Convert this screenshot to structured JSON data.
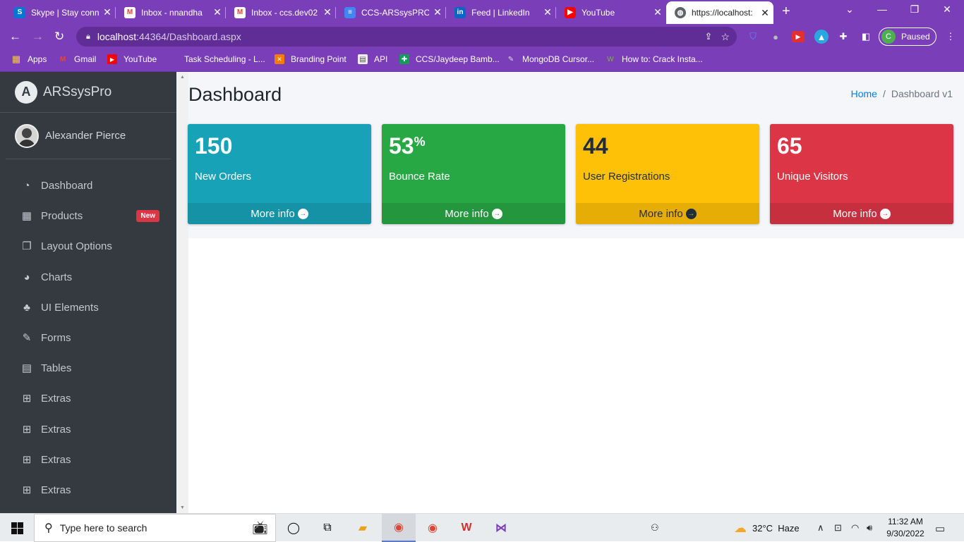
{
  "browser": {
    "tabs": [
      {
        "title": "Skype | Stay conn",
        "icon": "skype-icon",
        "icon_color": "#0078d4"
      },
      {
        "title": "Inbox - nnandha",
        "icon": "gmail-icon",
        "icon_color": "#ea4335"
      },
      {
        "title": "Inbox - ccs.dev02",
        "icon": "gmail-icon",
        "icon_color": "#ea4335"
      },
      {
        "title": "CCS-ARSsysPRO_",
        "icon": "docs-icon",
        "icon_color": "#4285f4"
      },
      {
        "title": "Feed | LinkedIn",
        "icon": "linkedin-icon",
        "icon_color": "#0a66c2"
      },
      {
        "title": "YouTube",
        "icon": "youtube-icon",
        "icon_color": "#ff0000"
      },
      {
        "title": "https://localhost:",
        "icon": "globe-icon",
        "icon_color": "#5f6368"
      }
    ],
    "url_host": "localhost",
    "url_path": ":44364/Dashboard.aspx",
    "profile_initial": "C",
    "profile_status": "Paused",
    "bookmarks": [
      {
        "label": "Apps",
        "icon": "apps-grid-icon"
      },
      {
        "label": "Gmail",
        "icon": "gmail-icon"
      },
      {
        "label": "YouTube",
        "icon": "youtube-icon"
      },
      {
        "label": "Task Scheduling - L...",
        "icon": "bookmark-icon"
      },
      {
        "label": "Branding Point",
        "icon": "branding-icon"
      },
      {
        "label": "API",
        "icon": "page-icon"
      },
      {
        "label": "CCS/Jaydeep Bamb...",
        "icon": "sheets-icon"
      },
      {
        "label": "MongoDB Cursor...",
        "icon": "mongodb-icon"
      },
      {
        "label": "How to: Crack Insta...",
        "icon": "wonderhowto-icon"
      }
    ]
  },
  "sidebar": {
    "brand": "ARSsysPro",
    "brand_initial": "A",
    "user_name": "Alexander Pierce",
    "items": [
      {
        "label": "Dashboard",
        "icon": "tachometer-icon",
        "glyph": "◔"
      },
      {
        "label": "Products",
        "icon": "grid-icon",
        "glyph": "▦",
        "badge": "New"
      },
      {
        "label": "Layout Options",
        "icon": "copy-icon",
        "glyph": "❐"
      },
      {
        "label": "Charts",
        "icon": "pie-chart-icon",
        "glyph": "◕"
      },
      {
        "label": "UI Elements",
        "icon": "tree-icon",
        "glyph": "♣"
      },
      {
        "label": "Forms",
        "icon": "edit-icon",
        "glyph": "✎"
      },
      {
        "label": "Tables",
        "icon": "table-icon",
        "glyph": "▤"
      },
      {
        "label": "Extras",
        "icon": "plus-square-icon",
        "glyph": "⊞"
      },
      {
        "label": "Extras",
        "icon": "plus-square-icon",
        "glyph": "⊞"
      },
      {
        "label": "Extras",
        "icon": "plus-square-icon",
        "glyph": "⊞"
      },
      {
        "label": "Extras",
        "icon": "plus-square-icon",
        "glyph": "⊞"
      }
    ]
  },
  "content": {
    "title": "Dashboard",
    "breadcrumb_home": "Home",
    "breadcrumb_sep": "/",
    "breadcrumb_current": "Dashboard v1",
    "boxes": [
      {
        "value": "150",
        "suffix": "",
        "label": "New Orders",
        "more": "More info",
        "bg": "#17a2b8",
        "foot_bg": "#1592a6",
        "text": "#ffffff"
      },
      {
        "value": "53",
        "suffix": "%",
        "label": "Bounce Rate",
        "more": "More info",
        "bg": "#28a745",
        "foot_bg": "#24963e",
        "text": "#ffffff"
      },
      {
        "value": "44",
        "suffix": "",
        "label": "User Registrations",
        "more": "More info",
        "bg": "#ffc107",
        "foot_bg": "#e6ad06",
        "text": "#1f2d3d"
      },
      {
        "value": "65",
        "suffix": "",
        "label": "Unique Visitors",
        "more": "More info",
        "bg": "#dc3545",
        "foot_bg": "#c6303e",
        "text": "#ffffff"
      }
    ]
  },
  "taskbar": {
    "search_placeholder": "Type here to search",
    "temperature": "32°C",
    "weather": "Haze",
    "time": "11:32 AM",
    "date": "9/30/2022"
  }
}
